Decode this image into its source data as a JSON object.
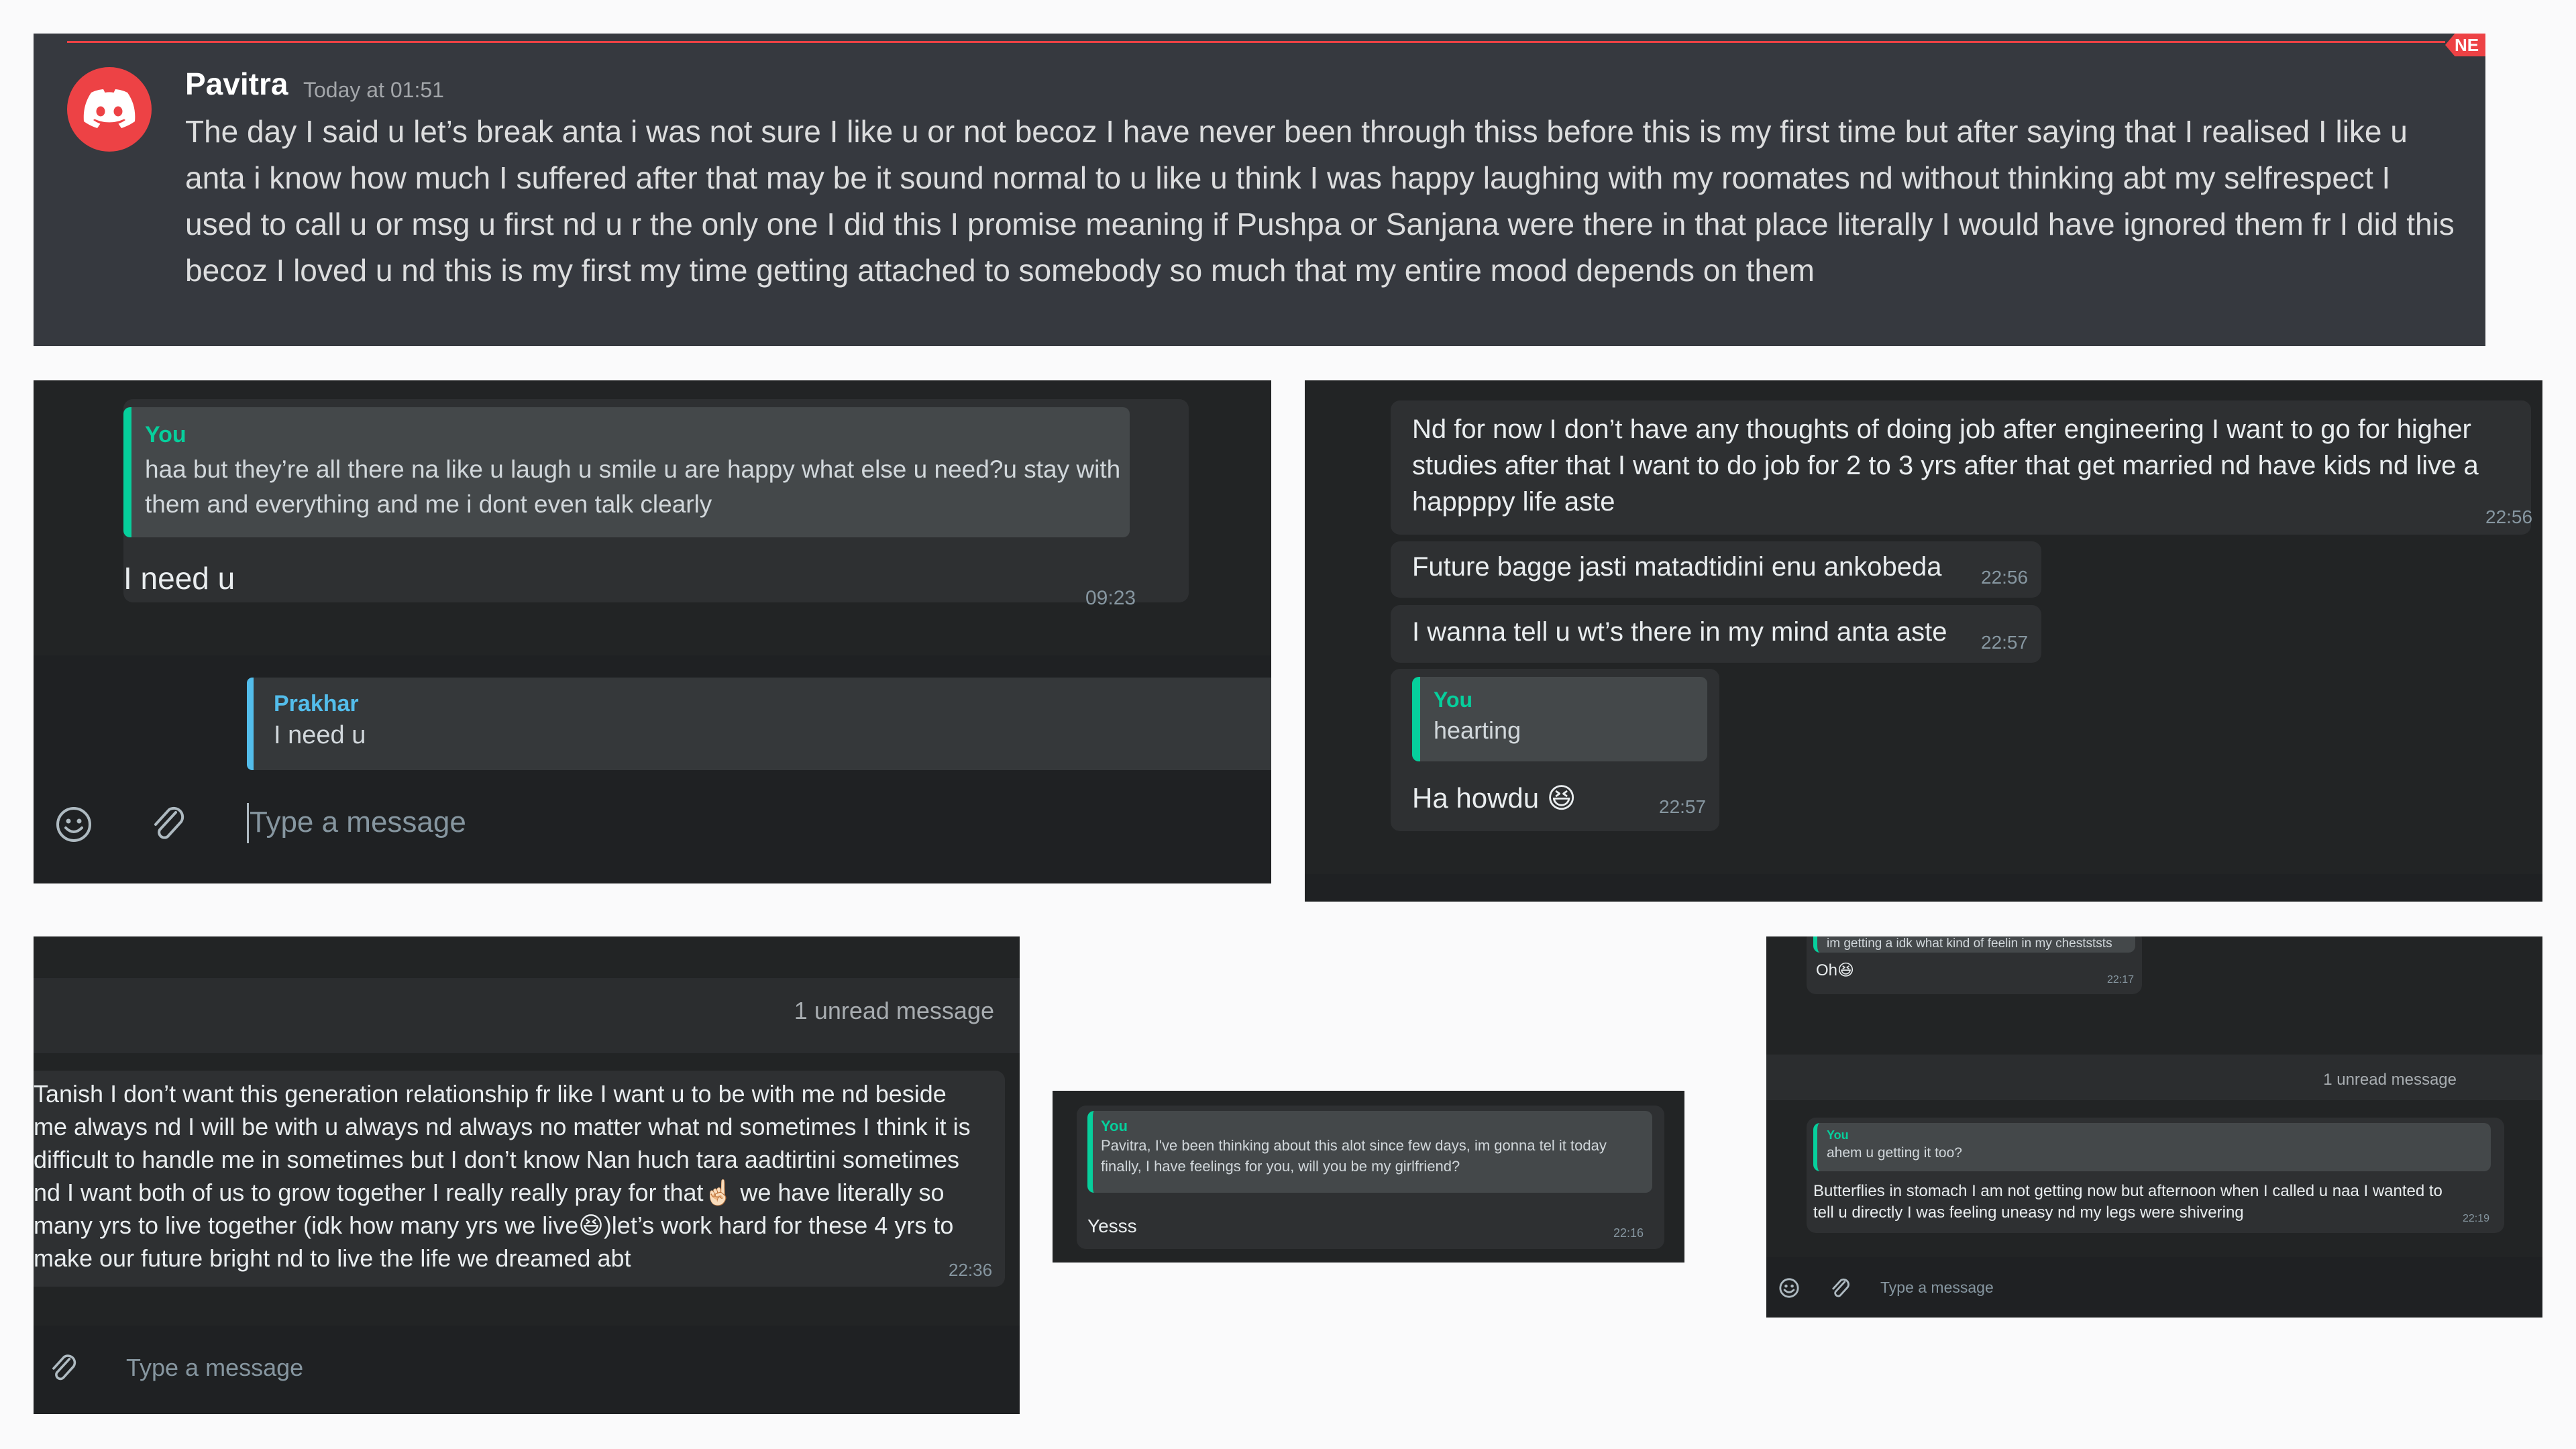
{
  "discord": {
    "author": "Pavitra",
    "timestamp": "Today at 01:51",
    "new_tag": "NE",
    "message": "The day I said u let’s break anta i was not sure I like u or not becoz I have never been through thiss before this is my first time but after saying that I realised I like u anta i know how much I suffered after that may be it sound normal to u like u think I was happy laughing with my roomates nd without thinking abt my selfrespect I used to call u or msg u first nd u r the only one I did this I promise meaning if Pushpa or Sanjana were there in that place  literally I would have ignored them fr I did this becoz I loved u nd this is my first my time getting attached to somebody so much that my entire mood depends on them",
    "colors": {
      "background": "#36393f",
      "accent": "#ed4245"
    }
  },
  "chat_reply_panel": {
    "quote_author": "You",
    "quote_text": "haa but they’re all there na like u laugh u smile u are happy what else u need?u stay with them and everything and me i dont even talk clearly",
    "message": "I need u",
    "time": "09:23",
    "reply_preview_author": "Prakhar",
    "reply_preview_text": "I need u",
    "input_placeholder": "Type a message",
    "icons": [
      "emoji-icon",
      "attach-icon"
    ]
  },
  "chat_future_panel": {
    "messages": [
      {
        "text": "Nd for now I don’t have any thoughts of doing job after engineering I want to go for higher studies after that  I want to do job for 2 to 3 yrs after that get married nd have kids nd live a happppy life aste",
        "time": "22:56"
      },
      {
        "text": "Future bagge jasti matadtidini enu ankobeda",
        "time": "22:56"
      },
      {
        "text": "I wanna tell u wt’s there in my mind anta aste",
        "time": "22:57"
      }
    ],
    "reply": {
      "quote_author": "You",
      "quote_text": "hearting",
      "text": "Ha howdu 😆",
      "time": "22:57"
    }
  },
  "chat_together_panel": {
    "unread_label": "1 unread message",
    "message": "Tanish I don’t want this generation relationship fr like I want u to be with me nd beside me always nd I will be with u always nd always no matter what nd sometimes I think it is difficult to handle me in sometimes but I don’t know Nan huch tara aadtirtini sometimes nd I want both of us to grow together I really really pray for that☝🏻 we have literally so many yrs to live together (idk how many yrs we live😆)let’s work hard for these 4 yrs to make our future bright nd to live the life we dreamed abt",
    "time": "22:36",
    "input_placeholder": "Type a message"
  },
  "chat_proposal_panel": {
    "quote_author": "You",
    "quote_text": "Pavitra, I've been thinking about this alot since few days, im gonna tel it today finally, I have feelings for you, will you be my girlfriend?",
    "message": "Yesss",
    "time": "22:16"
  },
  "chat_butterflies_panel": {
    "top_quote_text": "im getting a idk what kind of feelin in my chestststs",
    "top_message": "Oh😆",
    "top_time": "22:17",
    "unread_label": "1 unread message",
    "quote_author": "You",
    "quote_text": "ahem u getting it too?",
    "message": "Butterflies in stomach I am not getting now but afternoon when I called u naa I wanted to tell u directly I was feeling uneasy nd my legs were shivering",
    "time": "22:19",
    "input_placeholder": "Type a message"
  },
  "colors": {
    "whatsapp_bg": "#222425",
    "bubble": "#2e3032",
    "quote_accent": "#06cf9c",
    "reply_accent": "#53bdeb",
    "page": "#fafafb"
  }
}
